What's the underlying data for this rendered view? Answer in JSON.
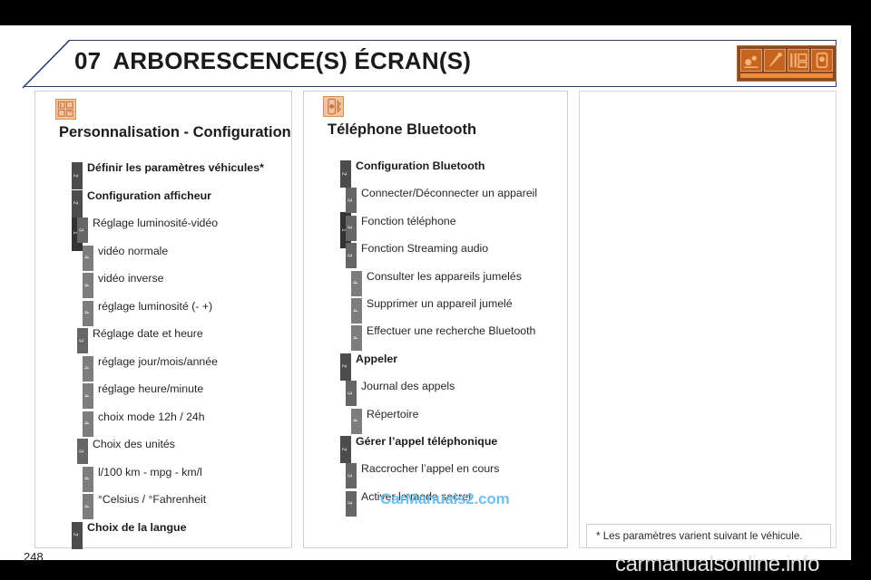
{
  "header": {
    "chapter_number": "07",
    "chapter_title": "ARBORESCENCE(S) ÉCRAN(S)",
    "icon_strip_name": "chapter-icon-strip",
    "icons": [
      "audio-icon",
      "wrench-icon",
      "controls-icon",
      "phone-icon"
    ],
    "border_color": "#2b3d6b",
    "icon_strip_color": "#8c4a22"
  },
  "columns": {
    "left": {
      "icon": "settings-panel-icon",
      "title": "Personnalisation - Configuration",
      "items": [
        {
          "level": 2,
          "text": "Définir les paramètres véhicules*",
          "bold": true
        },
        {
          "level": 2,
          "text": "Configuration afficheur",
          "bold": true
        },
        {
          "level": 3,
          "text": "Réglage luminosité-vidéo",
          "bold": false
        },
        {
          "level": 4,
          "text": "vidéo normale",
          "bold": false
        },
        {
          "level": 4,
          "text": "vidéo inverse",
          "bold": false
        },
        {
          "level": 4,
          "text": "réglage luminosité (- +)",
          "bold": false
        },
        {
          "level": 3,
          "text": "Réglage date et heure",
          "bold": false
        },
        {
          "level": 4,
          "text": "réglage jour/mois/année",
          "bold": false
        },
        {
          "level": 4,
          "text": "réglage heure/minute",
          "bold": false
        },
        {
          "level": 4,
          "text": "choix mode 12h / 24h",
          "bold": false
        },
        {
          "level": 3,
          "text": "Choix des unités",
          "bold": false
        },
        {
          "level": 4,
          "text": "l/100 km - mpg - km/l",
          "bold": false
        },
        {
          "level": 4,
          "text": "°Celsius / °Fahrenheit",
          "bold": false
        },
        {
          "level": 2,
          "text": "Choix de la langue",
          "bold": true
        }
      ]
    },
    "right": {
      "icon": "bluetooth-phone-icon",
      "title": "Téléphone Bluetooth",
      "items": [
        {
          "level": 2,
          "text": "Configuration Bluetooth",
          "bold": true
        },
        {
          "level": 3,
          "text": "Connecter/Déconnecter un appareil",
          "bold": false
        },
        {
          "level": 3,
          "text": "Fonction téléphone",
          "bold": false
        },
        {
          "level": 3,
          "text": "Fonction Streaming audio",
          "bold": false
        },
        {
          "level": 4,
          "text": "Consulter les appareils jumelés",
          "bold": false
        },
        {
          "level": 4,
          "text": "Supprimer un appareil jumelé",
          "bold": false
        },
        {
          "level": 4,
          "text": "Effectuer une recherche Bluetooth",
          "bold": false
        },
        {
          "level": 2,
          "text": "Appeler",
          "bold": true
        },
        {
          "level": 3,
          "text": "Journal des appels",
          "bold": false
        },
        {
          "level": 4,
          "text": "Répertoire",
          "bold": false
        },
        {
          "level": 2,
          "text": "Gérer l’appel téléphonique",
          "bold": true
        },
        {
          "level": 3,
          "text": "Raccrocher l’appel en cours",
          "bold": false
        },
        {
          "level": 3,
          "text": "Activer le mode secret",
          "bold": false
        }
      ]
    }
  },
  "footnote": "* Les paramètres varient suivant le véhicule.",
  "page_number": "248",
  "watermarks": {
    "center": "CarManuals2.com",
    "bottom": "carmanualsonline.info",
    "center_color": "#6ec1f0",
    "bottom_color": "#e2e2e2"
  },
  "level_markers": {
    "root": "1",
    "two": "2",
    "three": "3",
    "four": "4"
  }
}
